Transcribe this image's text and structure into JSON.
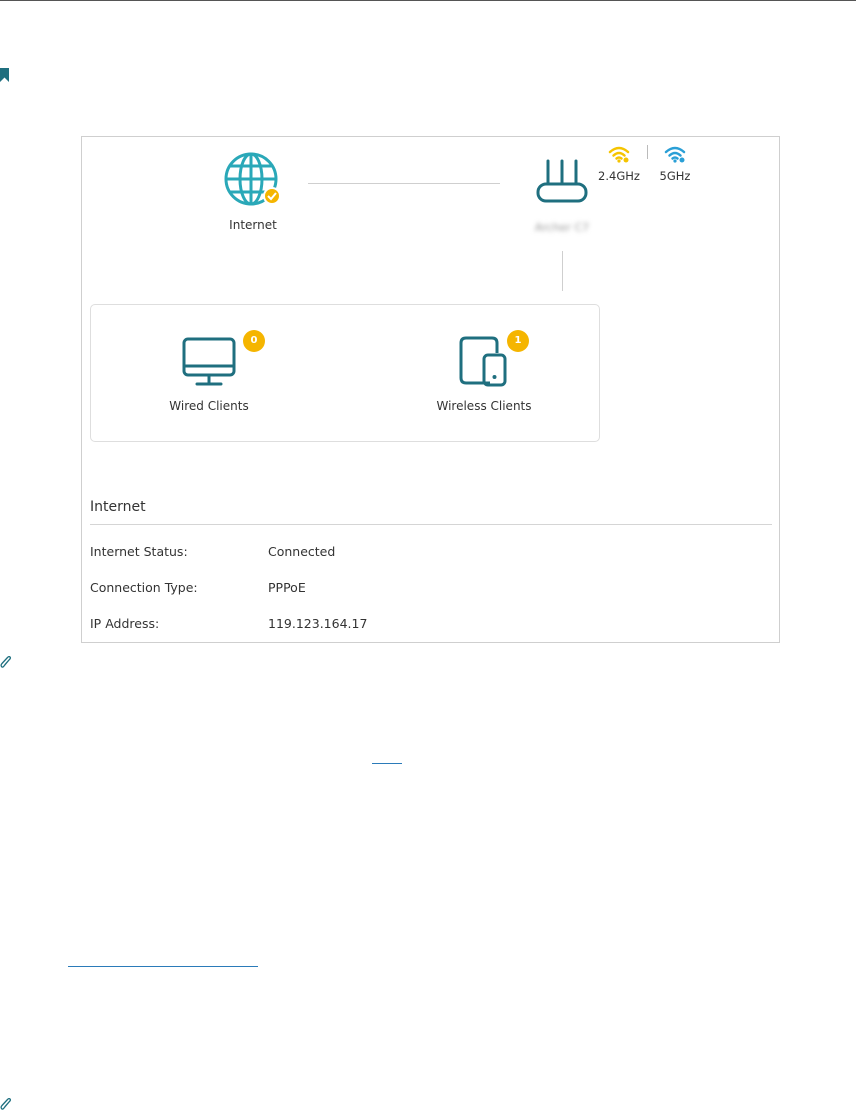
{
  "colors": {
    "accent_teal": "#1f6f7f",
    "globe_teal": "#2aa8b8",
    "badge_yellow": "#f5b500",
    "wifi_24_yellow": "#f5c400",
    "wifi_5_blue": "#2a9fd6"
  },
  "icons": {
    "bookmark": "bookmark-icon",
    "note": "paperclip-icon"
  },
  "topology": {
    "internet": {
      "label": "Internet",
      "icon": "globe-icon",
      "status_icon": "check-badge-icon"
    },
    "router": {
      "icon": "router-icon",
      "bands": [
        {
          "label": "2.4GHz",
          "icon": "wifi-icon"
        },
        {
          "label": "5GHz",
          "icon": "wifi-icon"
        }
      ]
    },
    "wired": {
      "label": "Wired Clients",
      "count": "0",
      "icon": "monitor-icon"
    },
    "wireless": {
      "label": "Wireless Clients",
      "count": "1",
      "icon": "tablet-phone-icon"
    }
  },
  "internet_panel": {
    "title": "Internet",
    "rows": [
      {
        "label": "Internet Status:",
        "value": "Connected"
      },
      {
        "label": "Connection Type:",
        "value": "PPPoE"
      },
      {
        "label": "IP Address:",
        "value": "119.123.164.17"
      }
    ]
  }
}
